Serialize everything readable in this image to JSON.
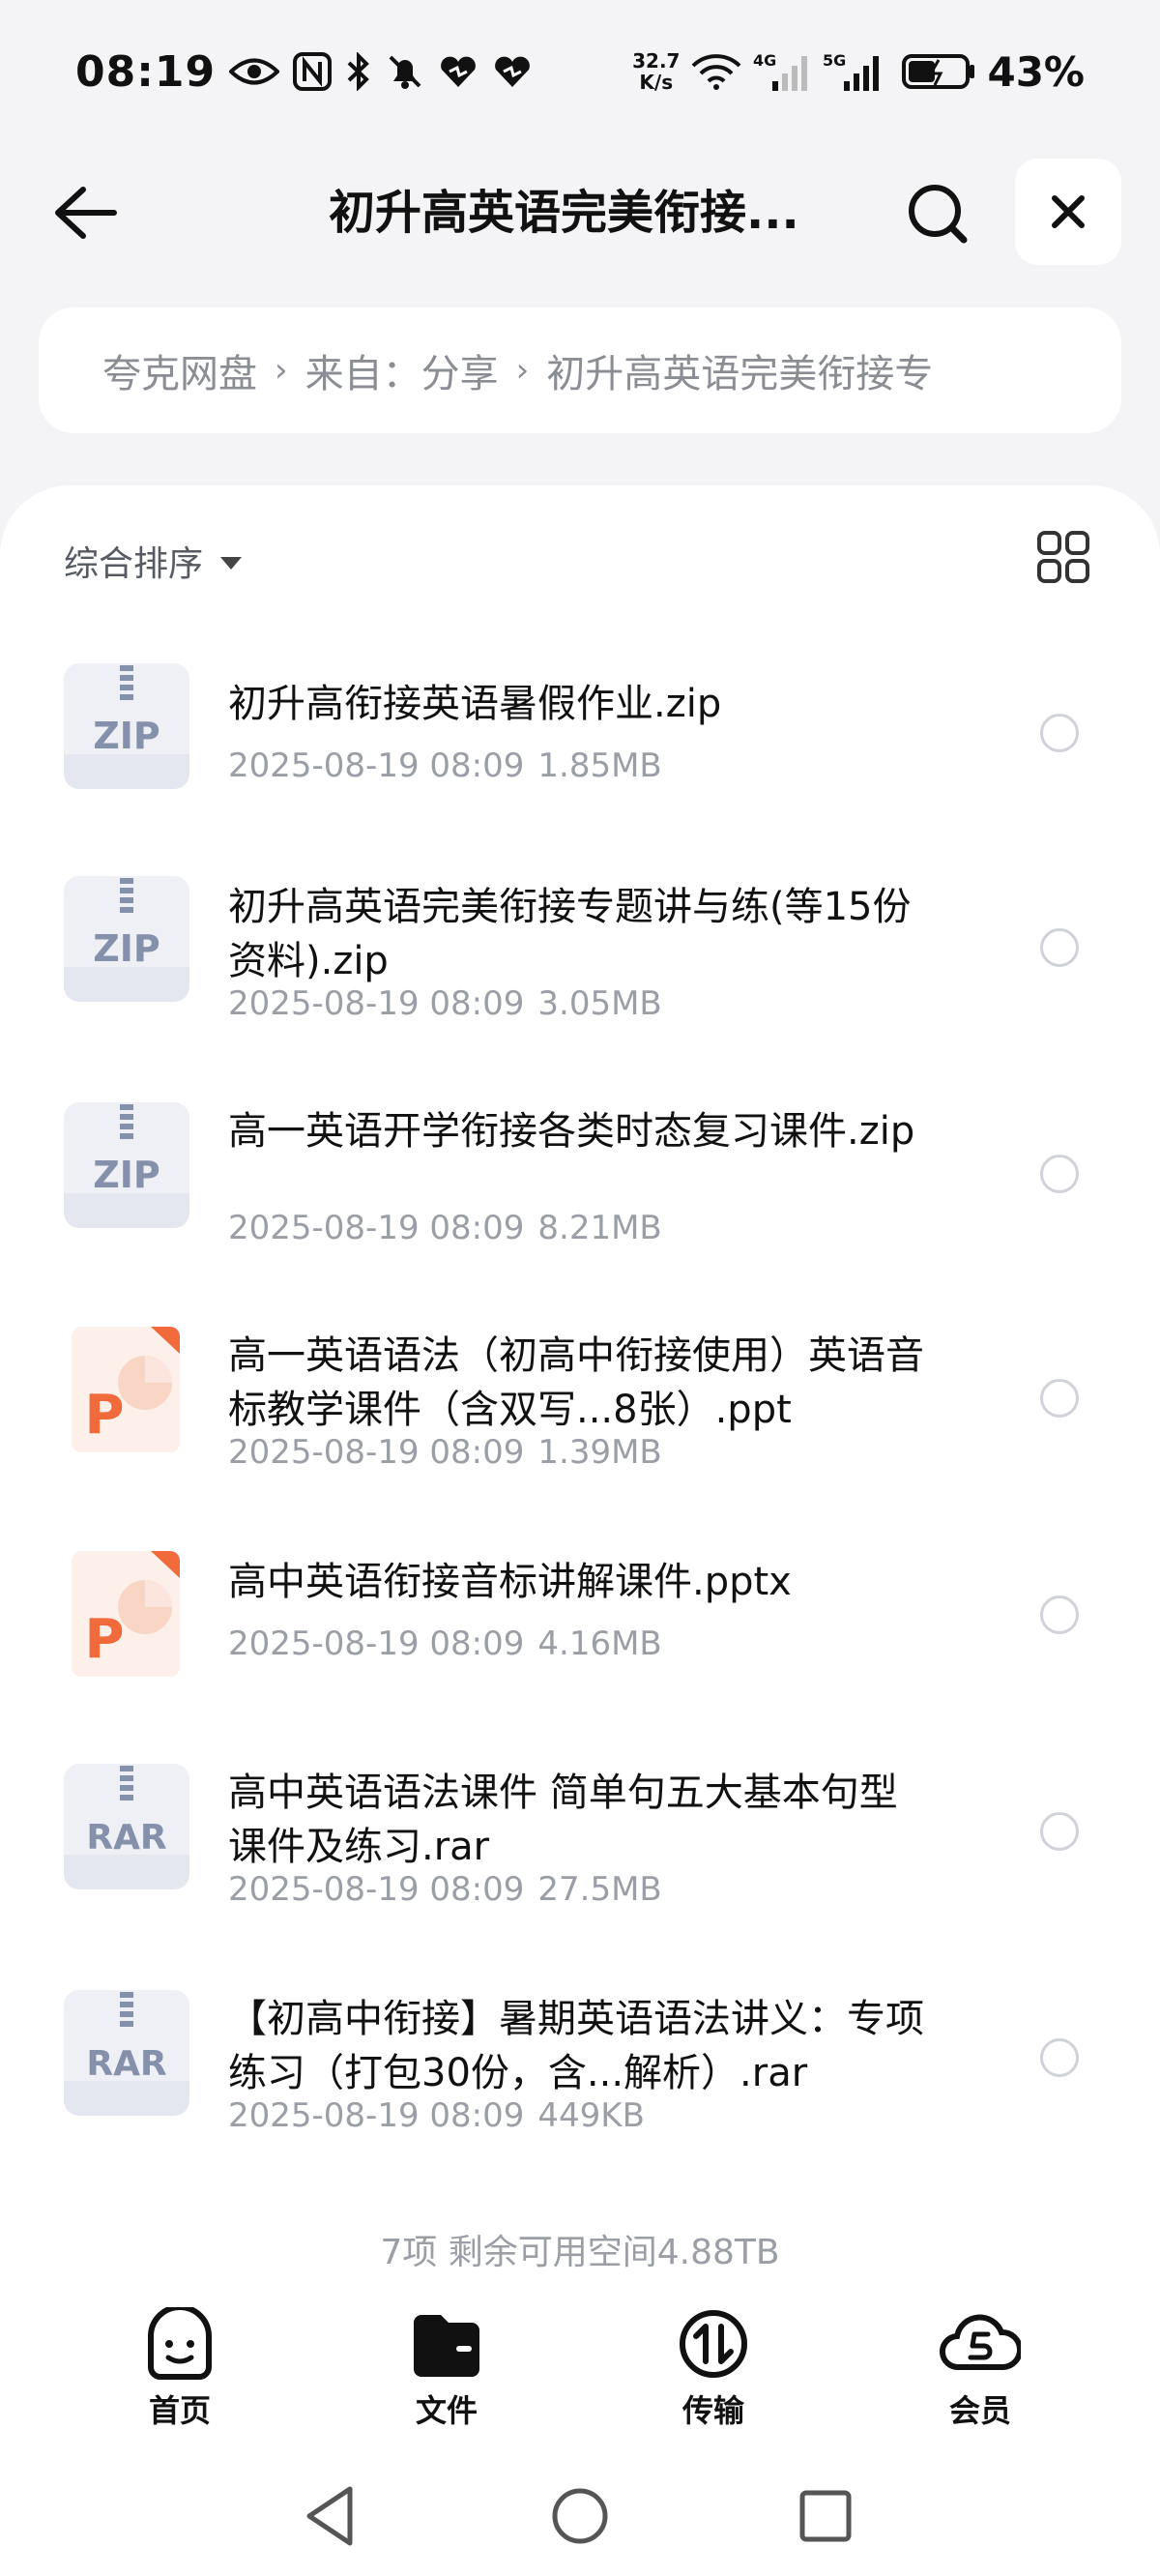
{
  "status_bar": {
    "time": "08:19",
    "net_speed_value": "32.7",
    "net_speed_unit": "K/s",
    "signal1_label": "4G",
    "signal2_label": "5G",
    "battery": "43%"
  },
  "header": {
    "title": "初升高英语完美衔接..."
  },
  "breadcrumb": {
    "items": [
      "夸克网盘",
      "来自：分享",
      "初升高英语完美衔接专"
    ]
  },
  "toolbar": {
    "sort_label": "综合排序"
  },
  "files": [
    {
      "type": "ZIP",
      "name": "初升高衔接英语暑假作业.zip",
      "date": "2025-08-19 08:09",
      "size": "1.85MB"
    },
    {
      "type": "ZIP",
      "name": "初升高英语完美衔接专题讲与练(等15份资料).zip",
      "date": "2025-08-19 08:09",
      "size": "3.05MB"
    },
    {
      "type": "ZIP",
      "name": "高一英语开学衔接各类时态复习课件.zip",
      "date": "2025-08-19 08:09",
      "size": "8.21MB"
    },
    {
      "type": "P",
      "name": "高一英语语法（初高中衔接使用）英语音标教学课件（含双写...8张）.ppt",
      "date": "2025-08-19 08:09",
      "size": "1.39MB"
    },
    {
      "type": "P",
      "name": "高中英语衔接音标讲解课件.pptx",
      "date": "2025-08-19 08:09",
      "size": "4.16MB"
    },
    {
      "type": "RAR",
      "name": "高中英语语法课件 简单句五大基本句型课件及练习.rar",
      "date": "2025-08-19 08:09",
      "size": "27.5MB"
    },
    {
      "type": "RAR",
      "name": "【初高中衔接】暑期英语语法讲义：专项练习（打包30份，含...解析）.rar",
      "date": "2025-08-19 08:09",
      "size": "449KB"
    }
  ],
  "footer": {
    "summary": "7项 剩余可用空间4.88TB"
  },
  "bottom_nav": [
    {
      "label": "首页",
      "icon": "home-face-icon"
    },
    {
      "label": "文件",
      "icon": "folder-icon"
    },
    {
      "label": "传输",
      "icon": "transfer-icon"
    },
    {
      "label": "会员",
      "icon": "cloud-vip-icon"
    }
  ],
  "colors": {
    "background": "#f4f4f6",
    "zip_icon": "#eef0f6",
    "zip_text": "#8590aa",
    "ppt_accent": "#f06a3b",
    "muted_text": "#9a9ea6"
  }
}
